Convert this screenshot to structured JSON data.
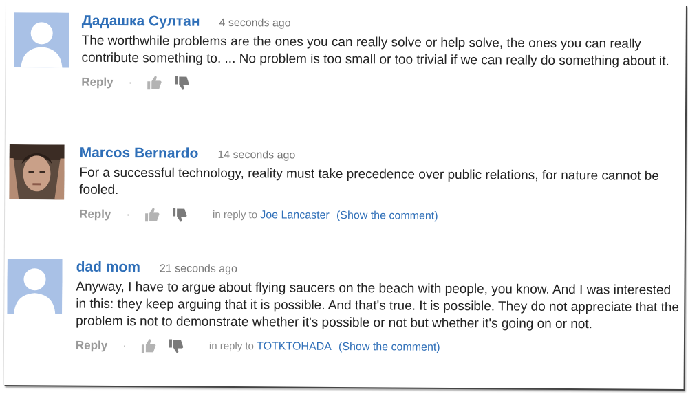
{
  "comments": [
    {
      "author": "Дадашка Султан",
      "time": "4 seconds ago",
      "text": "The worthwhile problems are the ones you can really solve or help solve, the ones you can really contribute something to. ... No problem is too small or too trivial if we can really do something about it.",
      "reply_label": "Reply",
      "in_reply_to": null
    },
    {
      "author": "Marcos Bernardo",
      "time": "14 seconds ago",
      "text": "For a successful technology, reality must take precedence over public relations, for nature cannot be fooled.",
      "reply_label": "Reply",
      "in_reply_label": "in reply to",
      "in_reply_to": "Joe Lancaster",
      "show_comment": "(Show the comment)"
    },
    {
      "author": "dad mom",
      "time": "21 seconds ago",
      "text": "Anyway, I have to argue about flying saucers on the beach with people, you know. And I was interested in this: they keep arguing that it is possible. And that's true. It is possible. They do not appreciate that the problem is not to demonstrate whether it's possible or not but whether it's going on or not.",
      "reply_label": "Reply",
      "in_reply_label": "in reply to",
      "in_reply_to": "TOTKTOHADA",
      "show_comment": "(Show the comment)"
    }
  ],
  "colors": {
    "link": "#2f6fb8",
    "muted": "#999999",
    "avatar_bg": "#a9c1e6"
  },
  "icons": {
    "thumb_up": "thumbs-up-icon",
    "thumb_down": "thumbs-down-icon"
  }
}
